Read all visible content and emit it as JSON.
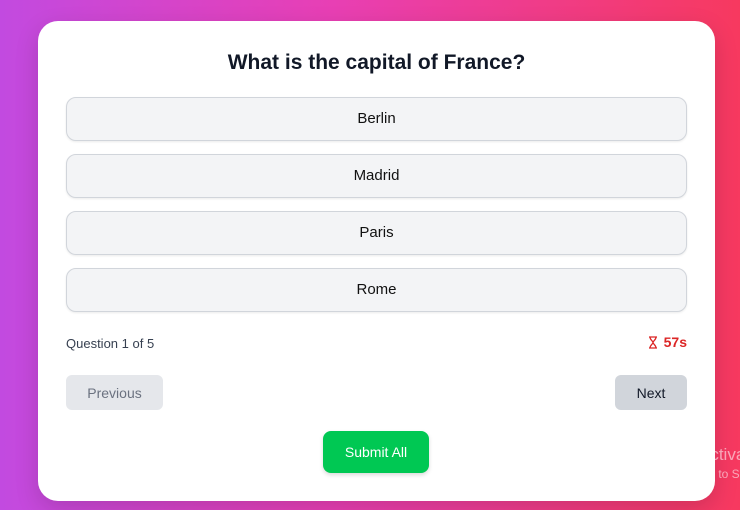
{
  "quiz": {
    "question": "What is the capital of France?",
    "options": [
      {
        "label": "Berlin"
      },
      {
        "label": "Madrid"
      },
      {
        "label": "Paris"
      },
      {
        "label": "Rome"
      }
    ],
    "progress_text": "Question 1 of 5",
    "timer": {
      "icon": "hourglass-icon",
      "value": "57s",
      "color": "#dc2626"
    },
    "previous_label": "Previous",
    "next_label": "Next",
    "submit_label": "Submit All"
  },
  "watermark": {
    "title": "Activa",
    "subtitle": "Go to S"
  },
  "colors": {
    "background_gradient": [
      "#c24ae0",
      "#e83fb4",
      "#f7395f"
    ],
    "submit": "#00c853",
    "option_bg": "#f3f4f6"
  }
}
